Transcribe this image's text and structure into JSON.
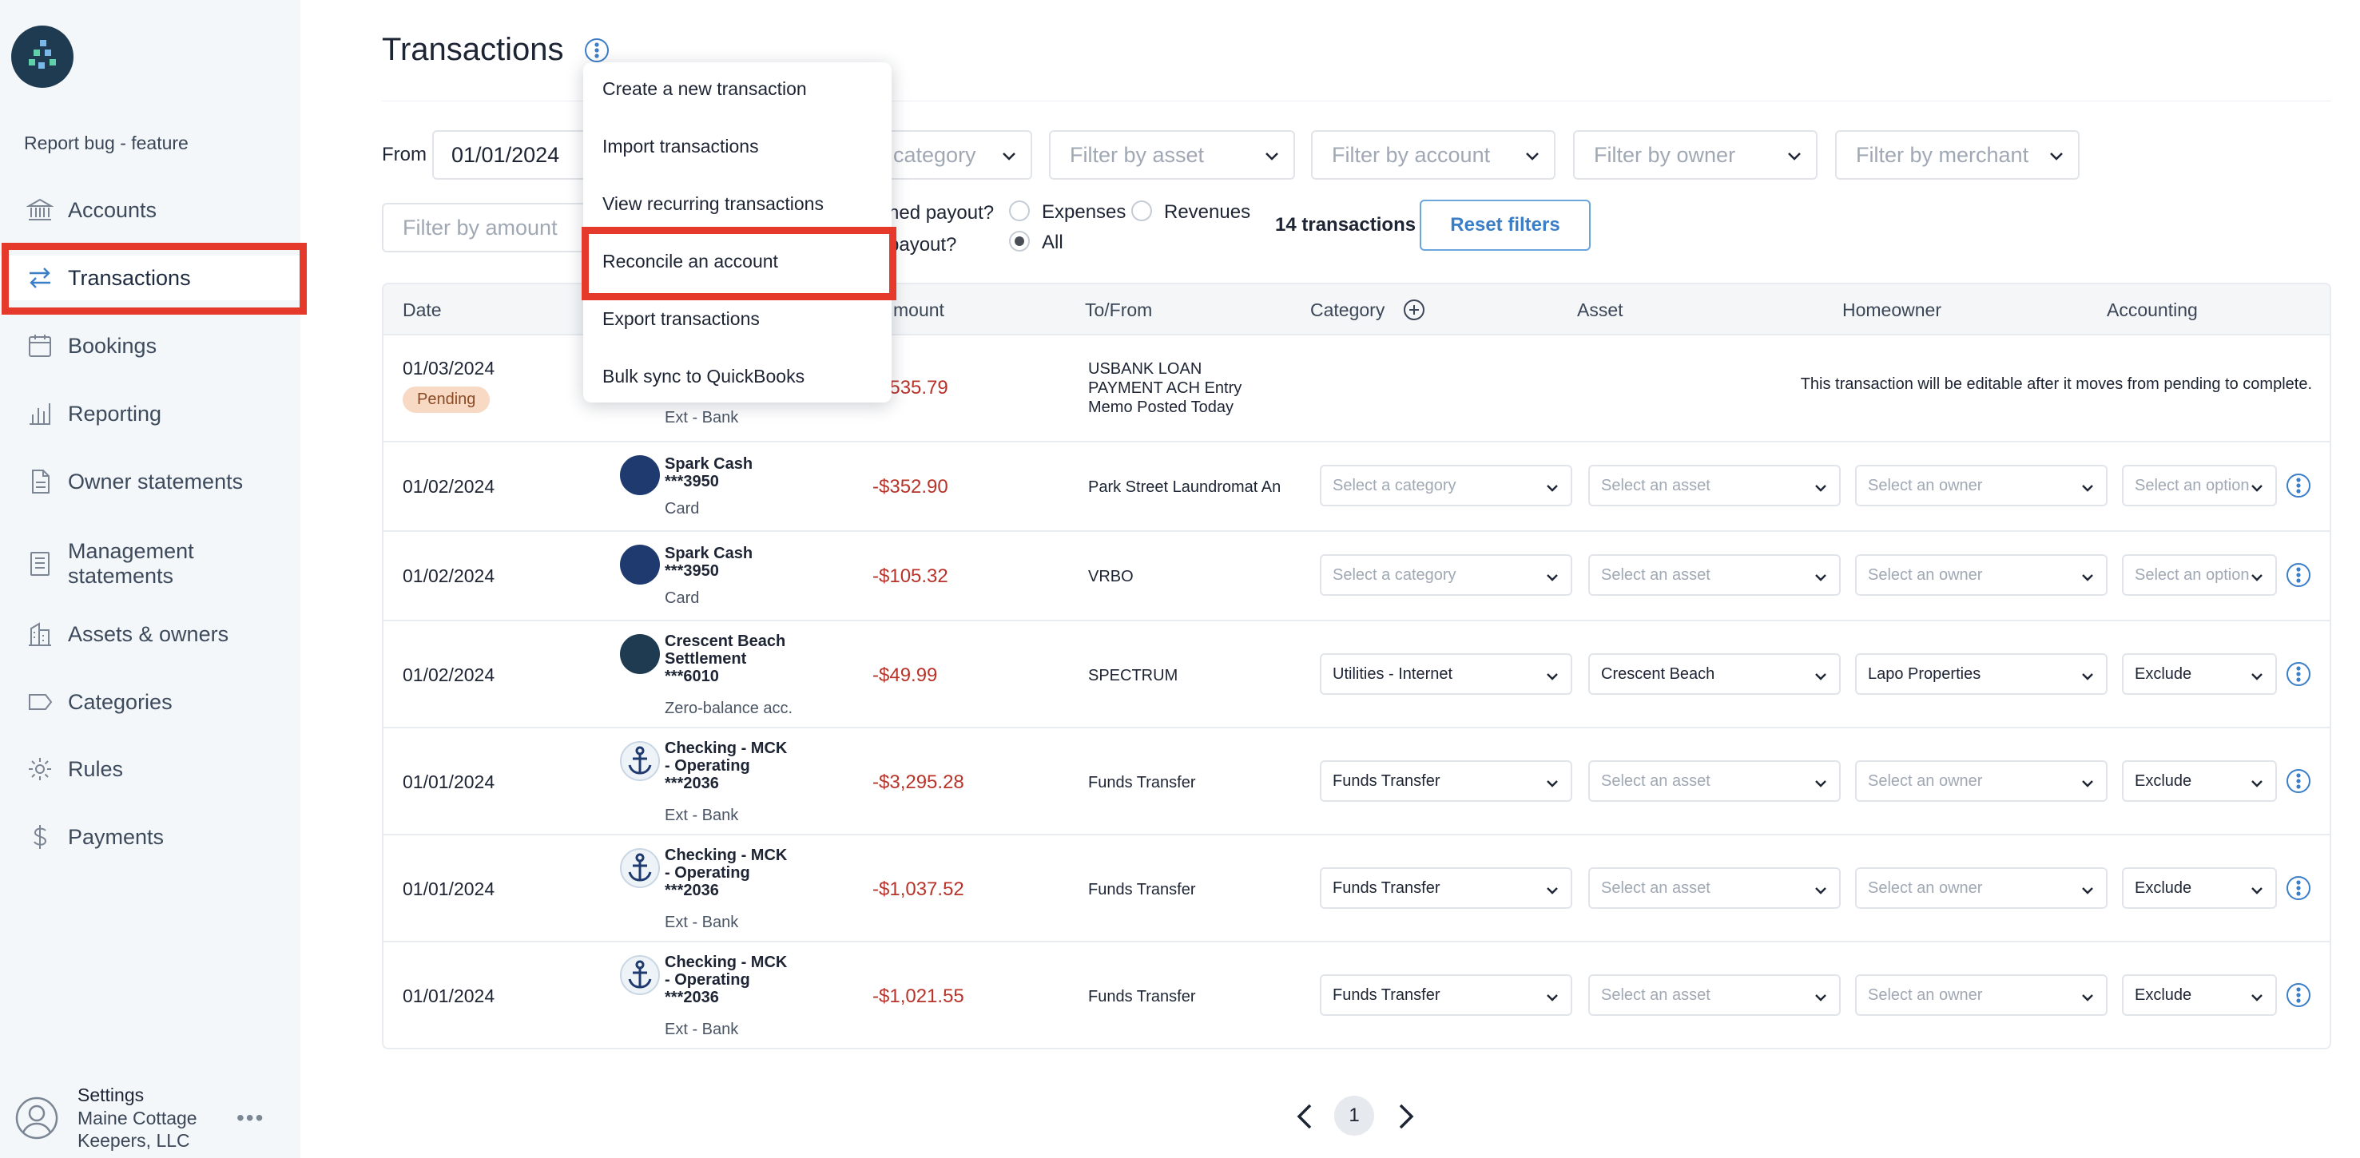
{
  "sidebar": {
    "report_bug": "Report bug - feature",
    "items": [
      {
        "label": "Accounts",
        "icon": "bank-icon"
      },
      {
        "label": "Transactions",
        "icon": "arrows-swap-icon",
        "active": true
      },
      {
        "label": "Bookings",
        "icon": "calendar-icon"
      },
      {
        "label": "Reporting",
        "icon": "bar-chart-icon"
      },
      {
        "label": "Owner statements",
        "icon": "document-icon"
      },
      {
        "label": "Management statements",
        "icon": "list-document-icon"
      },
      {
        "label": "Assets & owners",
        "icon": "building-icon"
      },
      {
        "label": "Categories",
        "icon": "tag-icon"
      },
      {
        "label": "Rules",
        "icon": "gear-icon"
      },
      {
        "label": "Payments",
        "icon": "dollar-icon"
      }
    ],
    "settings": {
      "title": "Settings",
      "org": "Maine Cottage Keepers, LLC",
      "more": "•••"
    }
  },
  "header": {
    "title": "Transactions"
  },
  "filters": {
    "from_label": "From",
    "from_value": "01/01/2024",
    "category_placeholder": "category",
    "asset_placeholder": "Filter by asset",
    "account_placeholder": "Filter by account",
    "owner_placeholder": "Filter by owner",
    "merchant_placeholder": "Filter by merchant",
    "amount_placeholder": "Filter by amount",
    "payout_q1": "ned payout?",
    "payout_q2": "payout?",
    "radio_expenses": "Expenses",
    "radio_revenues": "Revenues",
    "radio_all": "All",
    "tx_count": "14 transactions",
    "reset": "Reset filters"
  },
  "menu": {
    "items": [
      "Create a new transaction",
      "Import transactions",
      "View recurring transactions",
      "Reconcile an account",
      "Export transactions",
      "Bulk sync to QuickBooks"
    ]
  },
  "table": {
    "headers": [
      "Date",
      "mount",
      "To/From",
      "Category",
      "Asset",
      "Homeowner",
      "Accounting"
    ],
    "pending_label": "Pending",
    "pending_message": "This transaction will be editable after it moves from pending to complete.",
    "rows": [
      {
        "date": "01/03/2024",
        "account_name": "",
        "account_type": "Ext - Bank",
        "amount": "-$535.79",
        "to_from": "USBANK LOAN PAYMENT ACH Entry Memo Posted Today"
      },
      {
        "date": "01/02/2024",
        "account_name": "Spark Cash ***3950",
        "account_type": "Card",
        "amount": "-$352.90",
        "to_from": "Park Street Laundromat An",
        "category": "Select a category",
        "asset": "Select an asset",
        "owner": "Select an owner",
        "accounting": "Select an option"
      },
      {
        "date": "01/02/2024",
        "account_name": "Spark Cash ***3950",
        "account_type": "Card",
        "amount": "-$105.32",
        "to_from": "VRBO",
        "category": "Select a category",
        "asset": "Select an asset",
        "owner": "Select an owner",
        "accounting": "Select an option"
      },
      {
        "date": "01/02/2024",
        "account_name": "Crescent Beach Settlement ***6010",
        "account_type": "Zero-balance acc.",
        "amount": "-$49.99",
        "to_from": "SPECTRUM",
        "category": "Utilities - Internet",
        "asset": "Crescent Beach",
        "owner": "Lapo Properties",
        "accounting": "Exclude"
      },
      {
        "date": "01/01/2024",
        "account_name": "Checking - MCK - Operating ***2036",
        "account_type": "Ext - Bank",
        "amount": "-$3,295.28",
        "to_from": "Funds Transfer",
        "category": "Funds Transfer",
        "asset": "Select an asset",
        "owner": "Select an owner",
        "accounting": "Exclude"
      },
      {
        "date": "01/01/2024",
        "account_name": "Checking - MCK - Operating ***2036",
        "account_type": "Ext - Bank",
        "amount": "-$1,037.52",
        "to_from": "Funds Transfer",
        "category": "Funds Transfer",
        "asset": "Select an asset",
        "owner": "Select an owner",
        "accounting": "Exclude"
      },
      {
        "date": "01/01/2024",
        "account_name": "Checking - MCK - Operating ***2036",
        "account_type": "Ext - Bank",
        "amount": "-$1,021.55",
        "to_from": "Funds Transfer",
        "category": "Funds Transfer",
        "asset": "Select an asset",
        "owner": "Select an owner",
        "accounting": "Exclude"
      }
    ]
  },
  "pagination": {
    "current": "1"
  },
  "colors": {
    "accent": "#3b7ec8",
    "highlight": "#e53a2b",
    "negative": "#b8332a",
    "pending_bg": "#f7d9c4"
  }
}
